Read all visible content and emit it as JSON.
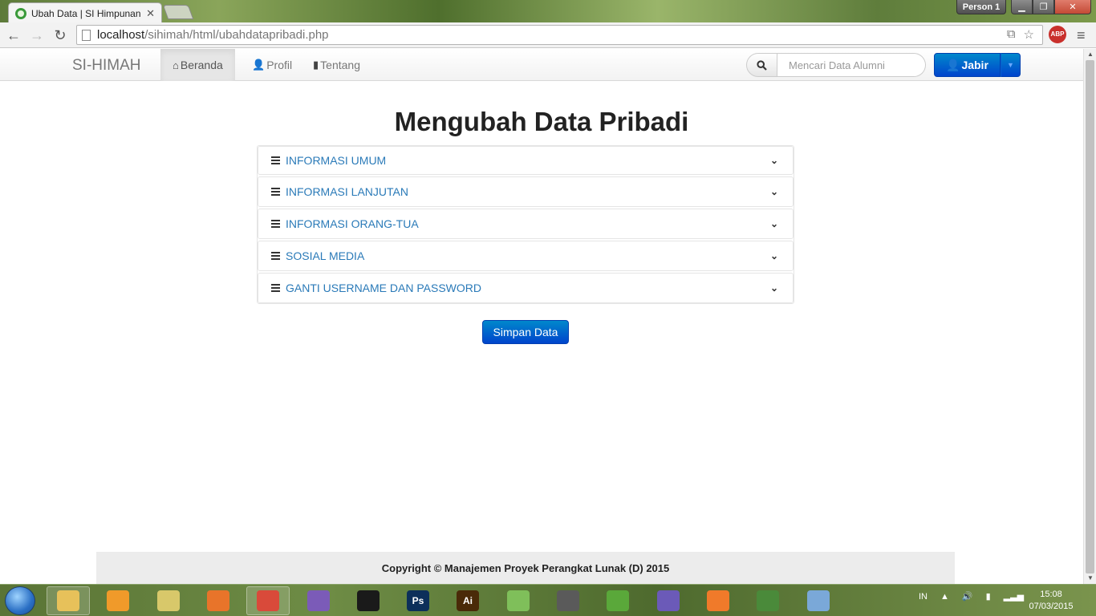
{
  "browser": {
    "tab_title": "Ubah Data | SI Himpunan",
    "person_label": "Person 1",
    "url_host": "localhost",
    "url_path": "/sihimah/html/ubahdatapribadi.php",
    "extension_badge": "ABP"
  },
  "navbar": {
    "brand": "SI-HIMAH",
    "items": [
      {
        "label": "Beranda",
        "icon": "home-icon",
        "active": true
      },
      {
        "label": "Profil",
        "icon": "user-icon",
        "active": false
      },
      {
        "label": "Tentang",
        "icon": "bookmark-icon",
        "active": false
      }
    ],
    "search": {
      "placeholder": "Mencari Data Alumni",
      "value": ""
    },
    "user": {
      "label": "Jabir"
    }
  },
  "main": {
    "title": "Mengubah Data Pribadi",
    "sections": [
      {
        "label": "INFORMASI UMUM"
      },
      {
        "label": "INFORMASI LANJUTAN"
      },
      {
        "label": "INFORMASI ORANG-TUA"
      },
      {
        "label": "SOSIAL MEDIA"
      },
      {
        "label": "GANTI USERNAME DAN PASSWORD"
      }
    ],
    "save_label": "Simpan Data"
  },
  "footer": {
    "text": "Copyright © Manajemen Proyek Perangkat Lunak (D) 2015"
  },
  "taskbar": {
    "language": "IN",
    "time": "15:08",
    "date": "07/03/2015",
    "apps": [
      {
        "name": "file-explorer-icon",
        "color": "#e7c15a"
      },
      {
        "name": "media-player-icon",
        "color": "#f09a2a"
      },
      {
        "name": "folder-icon",
        "color": "#d8c86a"
      },
      {
        "name": "firefox-icon",
        "color": "#e8742a"
      },
      {
        "name": "chrome-icon",
        "color": "#d94a3a"
      },
      {
        "name": "visual-studio-icon",
        "color": "#7b5bb8"
      },
      {
        "name": "command-prompt-icon",
        "color": "#1a1a1a"
      },
      {
        "name": "photoshop-icon",
        "color": "#0c2f5a",
        "text": "Ps"
      },
      {
        "name": "illustrator-icon",
        "color": "#4a2a08",
        "text": "Ai"
      },
      {
        "name": "notepad-plus-icon",
        "color": "#7fbf5a"
      },
      {
        "name": "sourcetree-icon",
        "color": "#5a5a5a"
      },
      {
        "name": "evernote-icon",
        "color": "#5aa83a"
      },
      {
        "name": "github-icon",
        "color": "#6b5ab8"
      },
      {
        "name": "xampp-icon",
        "color": "#f07a2a"
      },
      {
        "name": "editor-icon",
        "color": "#4a8a3a"
      },
      {
        "name": "paint-icon",
        "color": "#7aa8d8"
      }
    ]
  }
}
